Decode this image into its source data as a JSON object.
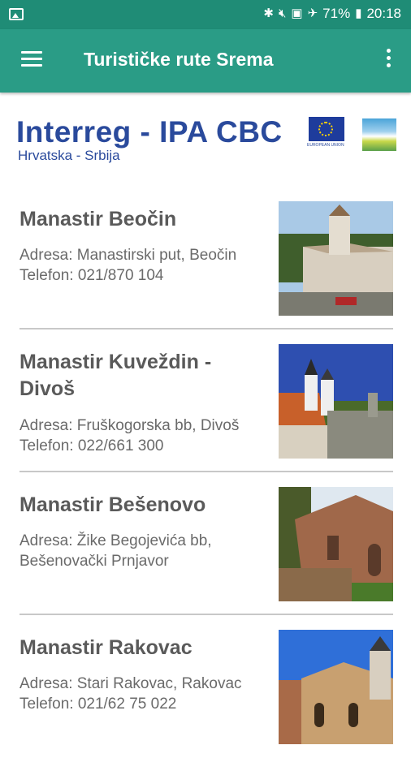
{
  "status": {
    "battery": "71%",
    "time": "20:18"
  },
  "appbar": {
    "title": "Turističke rute Srema"
  },
  "banner": {
    "logo_text": "Interreg - IPA CBC",
    "subtitle": "Hrvatska - Srbija",
    "eu_text": "EUROPEAN UNION"
  },
  "items": [
    {
      "name": "Manastir Beočin",
      "address": "Adresa: Manastirski put, Beočin",
      "phone": "Telefon: 021/870 104"
    },
    {
      "name": "Manastir Kuveždin - Divoš",
      "address": "Adresa: Fruškogorska bb, Divoš",
      "phone": "Telefon: 022/661 300"
    },
    {
      "name": "Manastir Bešenovo",
      "address": "Adresa: Žike Begojevića bb, Bešenovački Prnjavor",
      "phone": ""
    },
    {
      "name": "Manastir Rakovac",
      "address": "Adresa: Stari Rakovac, Rakovac",
      "phone": "Telefon: 021/62 75 022"
    }
  ]
}
